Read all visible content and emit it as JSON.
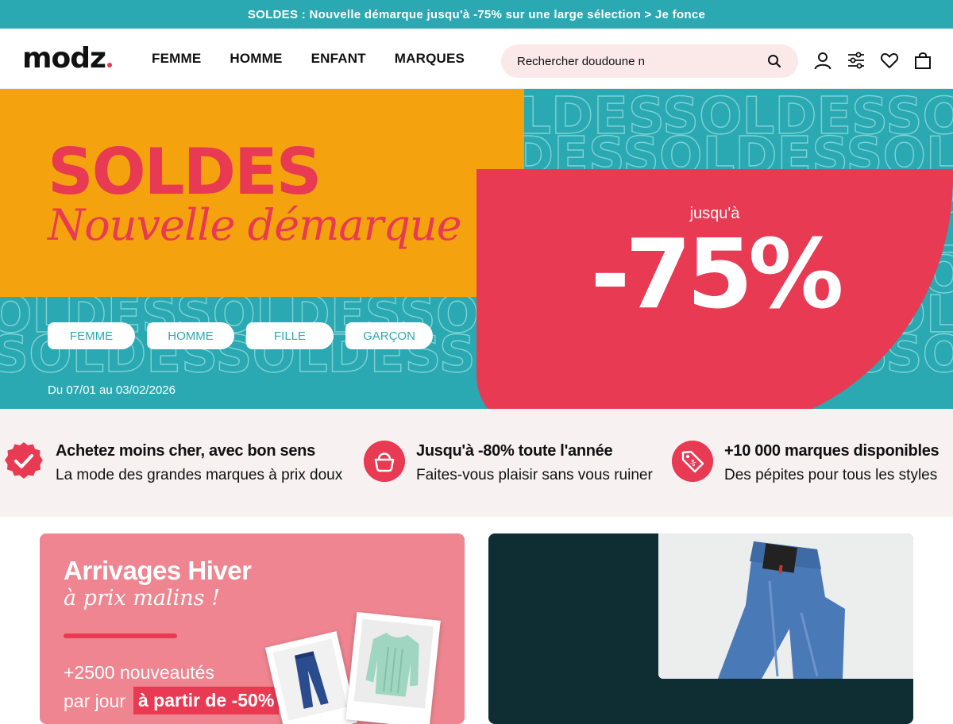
{
  "announcement": {
    "text": "SOLDES : Nouvelle démarque jusqu'à -75% sur une large sélection > Je fonce"
  },
  "header": {
    "logo": "modz",
    "nav": [
      "FEMME",
      "HOMME",
      "ENFANT",
      "MARQUES"
    ],
    "search": {
      "value": "Rechercher doudoune n",
      "icon": "search-icon"
    },
    "icons": [
      "user-icon",
      "filters-icon",
      "heart-icon",
      "bag-icon"
    ]
  },
  "hero": {
    "title": "SOLDES",
    "subtitle": "Nouvelle démarque",
    "upto": "jusqu'à",
    "discount": "-75%",
    "pills": [
      "FEMME",
      "HOMME",
      "FILLE",
      "GARÇON"
    ],
    "dates": "Du 07/01 au 03/02/2026",
    "pattern_word": "SOLDES",
    "colors": {
      "teal": "#2aa9b2",
      "orange": "#f5a20f",
      "red": "#e83a52"
    }
  },
  "benefits": [
    {
      "icon": "check-badge-icon",
      "title": "Achetez moins cher, avec bon sens",
      "desc": "La mode des grandes marques à prix doux"
    },
    {
      "icon": "basket-icon",
      "title": "Jusqu'à -80% toute l'année",
      "desc": "Faites-vous plaisir sans vous ruiner"
    },
    {
      "icon": "price-tag-icon",
      "title": "+10 000 marques disponibles",
      "desc": "Des pépites pour tous les styles"
    }
  ],
  "promo_winter": {
    "title": "Arrivages Hiver",
    "subtitle": "à prix malins !",
    "count": "+2500 nouveautés",
    "per_day": "par jour",
    "badge": "à partir de -50%"
  }
}
